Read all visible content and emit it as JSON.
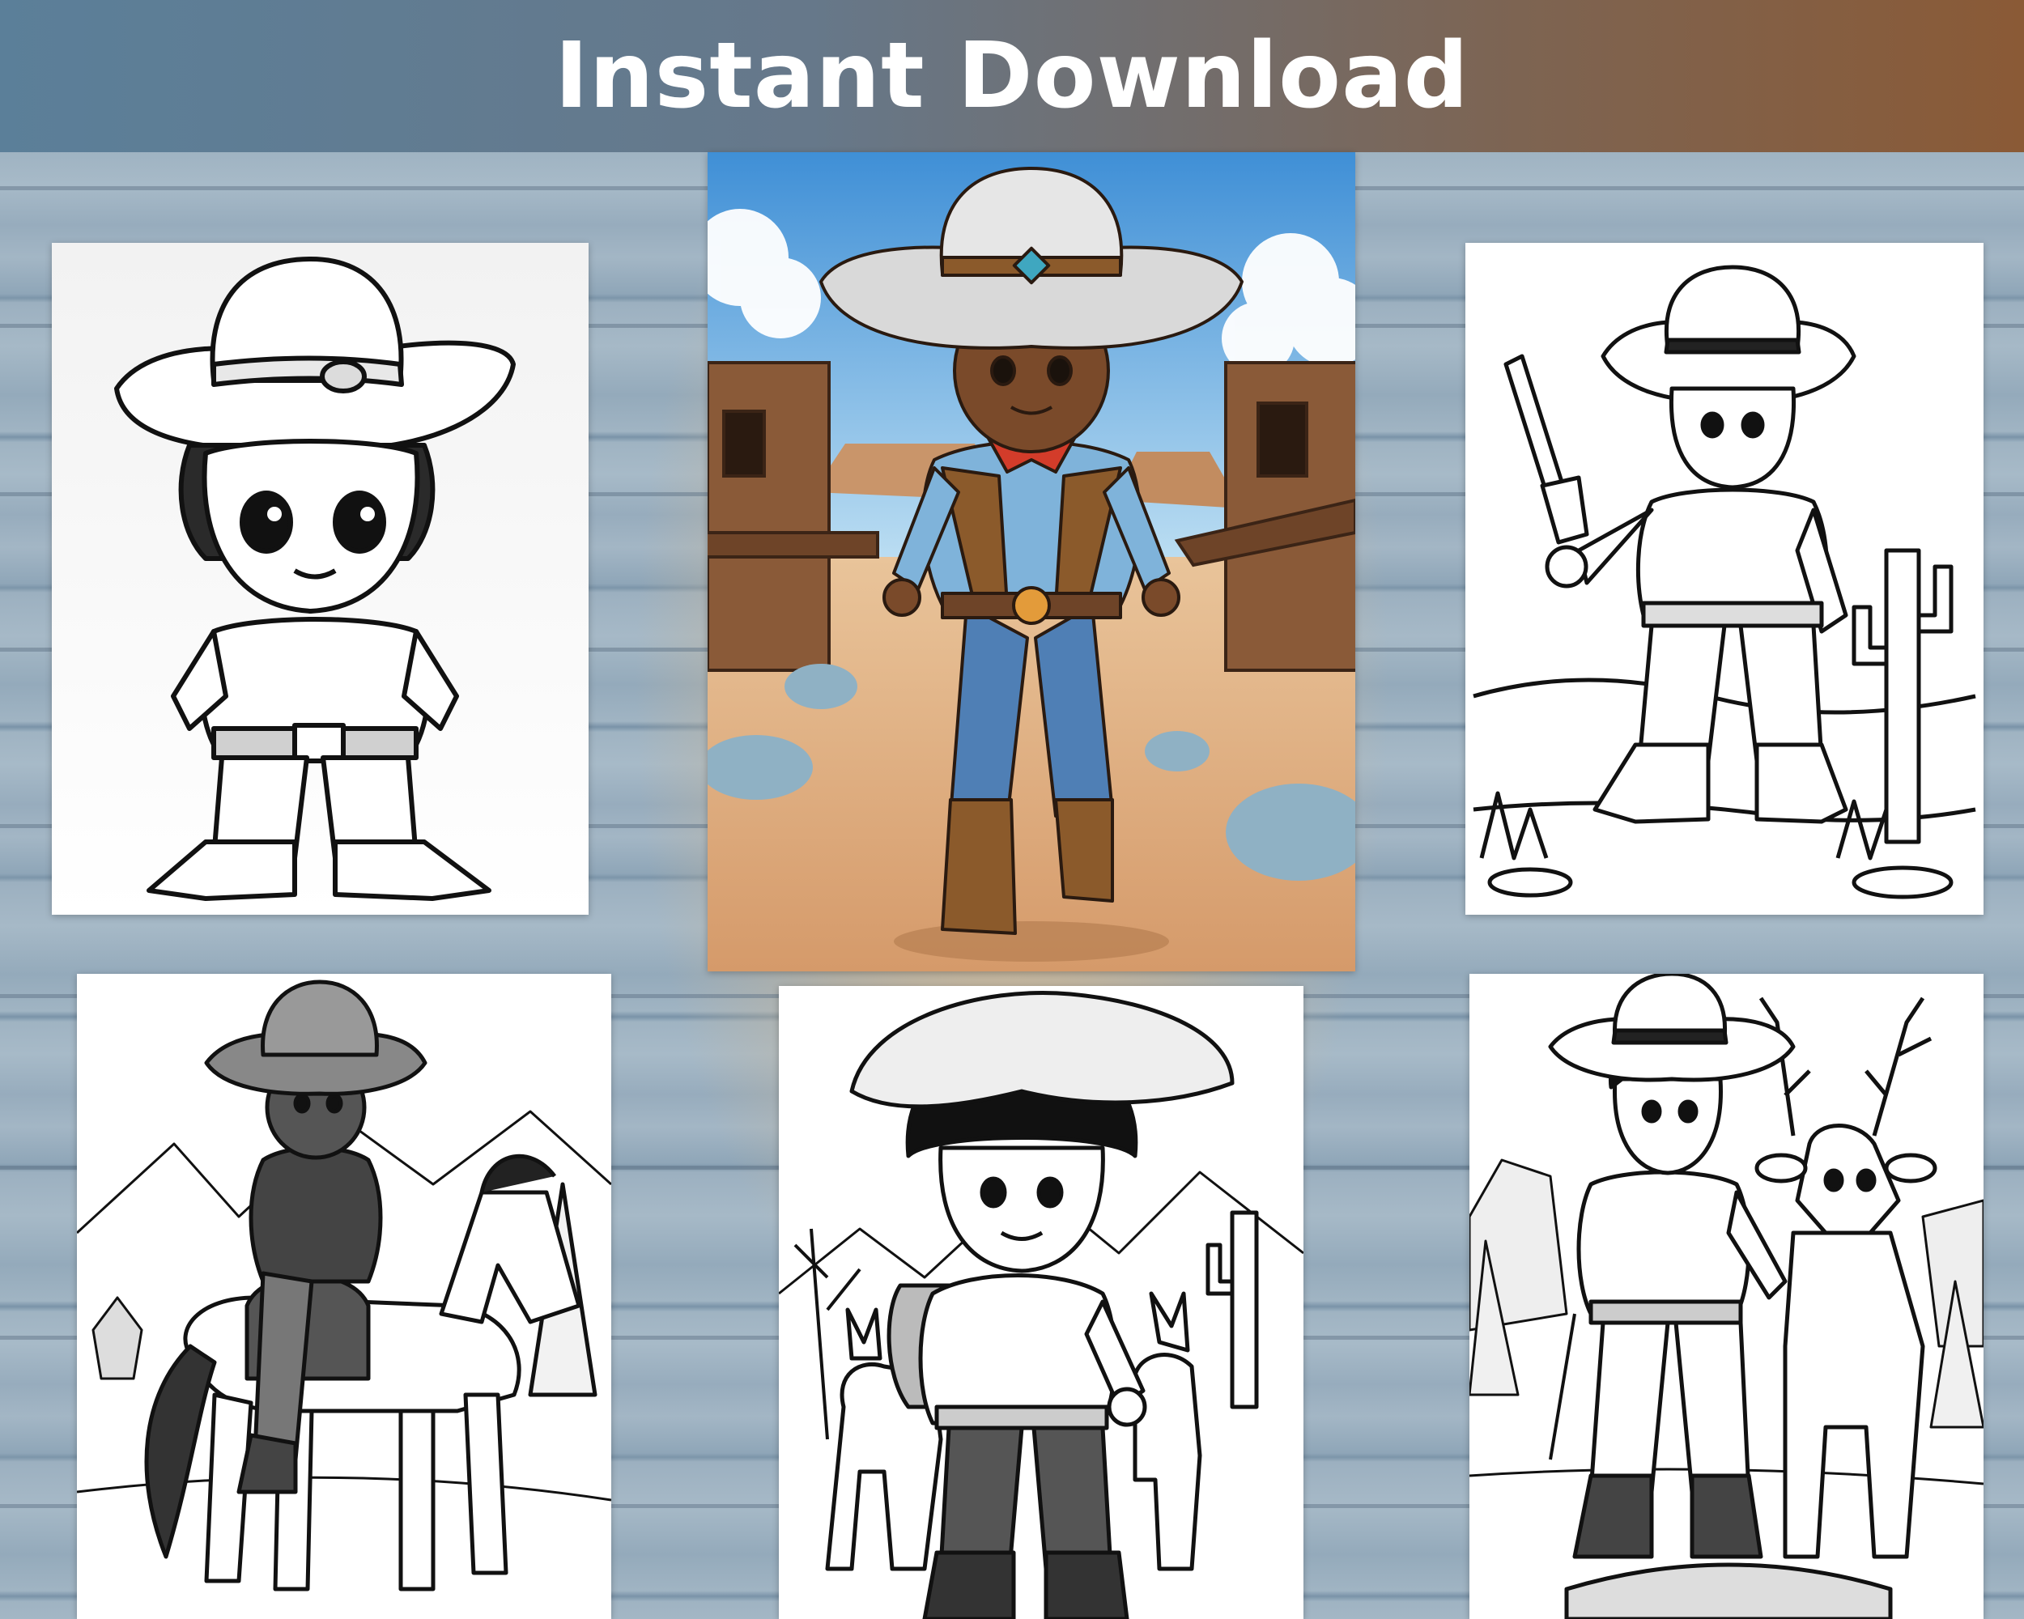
{
  "banner": {
    "title": "Instant Download"
  },
  "pages": [
    {
      "subject": "cowboy-boy-portrait",
      "style": "line-art"
    },
    {
      "subject": "cowboy-boy-ghost-town",
      "style": "full-color"
    },
    {
      "subject": "cowboy-boy-with-revolver-and-cactus",
      "style": "line-art"
    },
    {
      "subject": "cowboy-boy-riding-horse",
      "style": "line-art"
    },
    {
      "subject": "cowboy-boy-with-backpack-and-donkeys",
      "style": "line-art"
    },
    {
      "subject": "cowboy-boy-with-deer",
      "style": "line-art"
    }
  ],
  "colors": {
    "banner_left": "#5b7f99",
    "banner_right": "#8a5a36",
    "banner_text": "#ffffff",
    "wood": "#9fb3c2",
    "sky": "#4f9ad8",
    "sand": "#e2b487",
    "shirt": "#7fb3da",
    "jeans": "#4f7fb5",
    "skin": "#7a4a2a"
  }
}
